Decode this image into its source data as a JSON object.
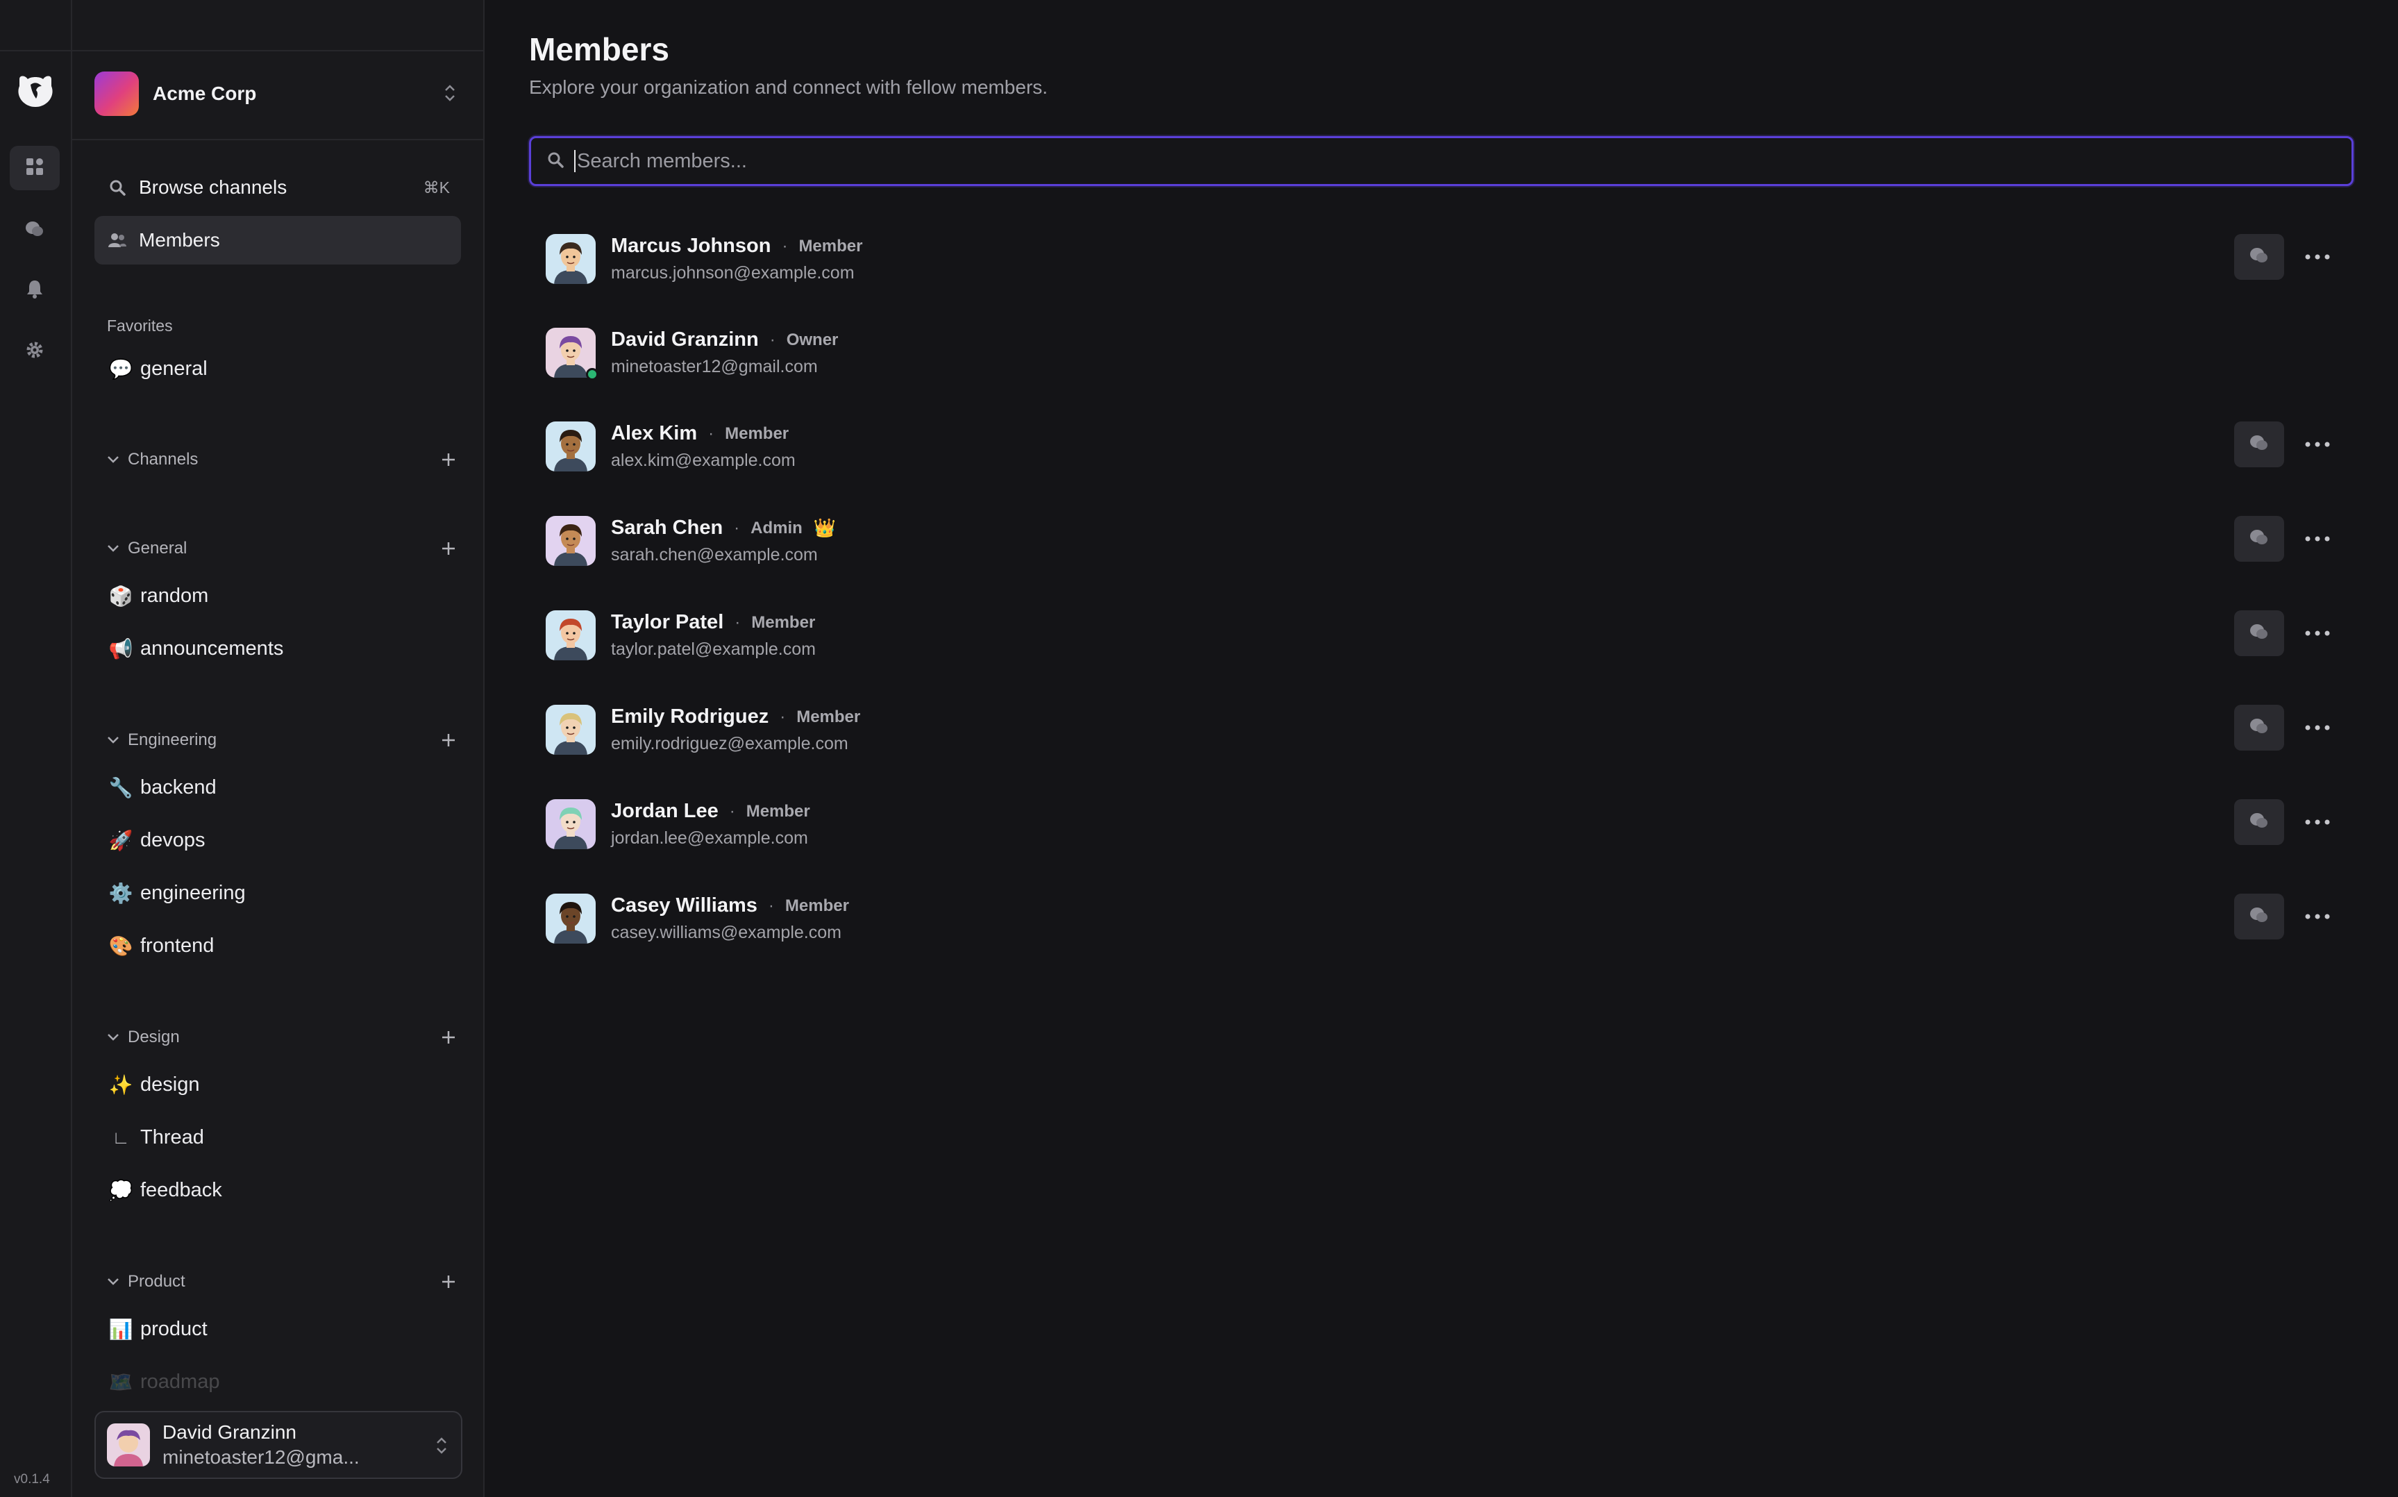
{
  "app": {
    "version": "v0.1.4"
  },
  "workspace": {
    "name": "Acme Corp"
  },
  "nav": {
    "browse_label": "Browse channels",
    "browse_shortcut": "⌘K",
    "members_label": "Members"
  },
  "favorites": {
    "title": "Favorites",
    "items": [
      {
        "emoji": "💬",
        "label": "general"
      }
    ]
  },
  "groups": {
    "channels": {
      "label": "Channels"
    },
    "general": {
      "label": "General",
      "items": [
        {
          "emoji": "🎲",
          "label": "random"
        },
        {
          "emoji": "📢",
          "label": "announcements"
        }
      ]
    },
    "engineering": {
      "label": "Engineering",
      "items": [
        {
          "emoji": "🔧",
          "label": "backend"
        },
        {
          "emoji": "🚀",
          "label": "devops"
        },
        {
          "emoji": "⚙️",
          "label": "engineering"
        },
        {
          "emoji": "🎨",
          "label": "frontend"
        }
      ]
    },
    "design": {
      "label": "Design",
      "items": [
        {
          "emoji": "✨",
          "label": "design"
        },
        {
          "emoji": "∟",
          "label": "Thread"
        },
        {
          "emoji": "💭",
          "label": "feedback"
        }
      ]
    },
    "product": {
      "label": "Product",
      "items": [
        {
          "emoji": "📊",
          "label": "product"
        },
        {
          "emoji": "🗺️",
          "label": "roadmap"
        }
      ]
    }
  },
  "current_user": {
    "name": "David Granzinn",
    "email": "minetoaster12@gma..."
  },
  "page": {
    "title": "Members",
    "subtitle": "Explore your organization and connect with fellow members.",
    "search_placeholder": "Search members...",
    "separator": "·"
  },
  "members": [
    {
      "name": "Marcus Johnson",
      "role": "Member",
      "email": "marcus.johnson@example.com",
      "avatar_bg": "#cfe6f3",
      "skin": "#f0c69a",
      "hair": "#3a2a1f"
    },
    {
      "name": "David Granzinn",
      "role": "Owner",
      "email": "minetoaster12@gmail.com",
      "avatar_bg": "#e9d3e2",
      "skin": "#f2cfae",
      "hair": "#7a4aa0"
    },
    {
      "name": "Alex Kim",
      "role": "Member",
      "email": "alex.kim@example.com",
      "avatar_bg": "#cfe6f3",
      "skin": "#a4703f",
      "hair": "#2a1c12"
    },
    {
      "name": "Sarah Chen",
      "role": "Admin",
      "email": "sarah.chen@example.com",
      "crown": "👑",
      "avatar_bg": "#e2d3f0",
      "skin": "#c48a56",
      "hair": "#3b2414"
    },
    {
      "name": "Taylor Patel",
      "role": "Member",
      "email": "taylor.patel@example.com",
      "avatar_bg": "#cfe6f3",
      "skin": "#f3c7a3",
      "hair": "#c2472a"
    },
    {
      "name": "Emily Rodriguez",
      "role": "Member",
      "email": "emily.rodriguez@example.com",
      "avatar_bg": "#cfe6f3",
      "skin": "#f1d2b3",
      "hair": "#d9c27a"
    },
    {
      "name": "Jordan Lee",
      "role": "Member",
      "email": "jordan.lee@example.com",
      "avatar_bg": "#d8cbee",
      "skin": "#f2dcc8",
      "hair": "#7fd1b5"
    },
    {
      "name": "Casey Williams",
      "role": "Member",
      "email": "casey.williams@example.com",
      "avatar_bg": "#cfe6f3",
      "skin": "#6b4528",
      "hair": "#1e140d"
    }
  ],
  "colors": {
    "accent": "#5a3fd8",
    "online": "#2bb673"
  }
}
